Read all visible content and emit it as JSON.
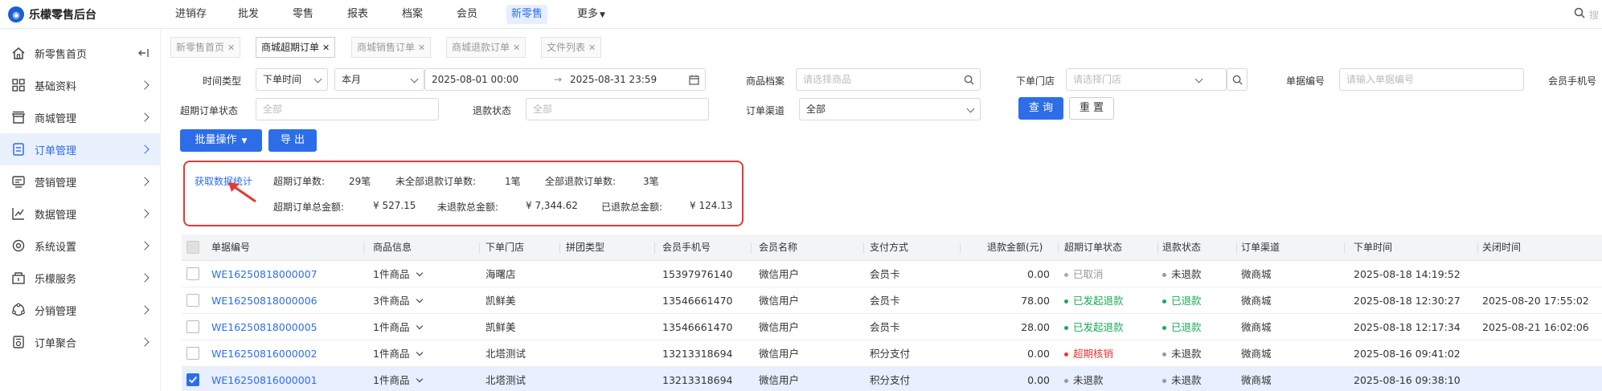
{
  "app": {
    "title": "乐檬零售后台"
  },
  "topnav": {
    "items": [
      {
        "label": "进销存"
      },
      {
        "label": "批发"
      },
      {
        "label": "零售"
      },
      {
        "label": "报表"
      },
      {
        "label": "档案"
      },
      {
        "label": "会员"
      },
      {
        "label": "新零售"
      },
      {
        "label": "更多"
      }
    ],
    "active": "新零售",
    "search_placeholder": "搜"
  },
  "sidebar": {
    "items": [
      {
        "label": "新零售首页",
        "icon": "home-icon"
      },
      {
        "label": "基础资料",
        "icon": "grid-icon"
      },
      {
        "label": "商城管理",
        "icon": "shop-icon"
      },
      {
        "label": "订单管理",
        "icon": "order-icon"
      },
      {
        "label": "营销管理",
        "icon": "marketing-icon"
      },
      {
        "label": "数据管理",
        "icon": "chart-icon"
      },
      {
        "label": "系统设置",
        "icon": "gear-icon"
      },
      {
        "label": "乐檬服务",
        "icon": "service-icon"
      },
      {
        "label": "分销管理",
        "icon": "distribution-icon"
      },
      {
        "label": "订单聚合",
        "icon": "aggregate-icon"
      }
    ],
    "active": "订单管理",
    "collapse_icon": "collapse-icon"
  },
  "tabs": [
    {
      "label": "新零售首页"
    },
    {
      "label": "商城超期订单"
    },
    {
      "label": "商城销售订单"
    },
    {
      "label": "商城退款订单"
    },
    {
      "label": "文件列表"
    }
  ],
  "filters": {
    "time_type_label": "时间类型",
    "time_type_value": "下单时间",
    "period_value": "本月",
    "start_time": "2025-08-01 00:00",
    "end_time": "2025-08-31 23:59",
    "product_label": "商品档案",
    "product_placeholder": "请选择商品",
    "store_label": "下单门店",
    "store_placeholder": "请选择门店",
    "doc_no_label": "单据编号",
    "doc_no_placeholder": "请输入单据编号",
    "member_phone_label": "会员手机号",
    "overdue_status_label": "超期订单状态",
    "overdue_status_value": "全部",
    "refund_status_label": "退款状态",
    "refund_status_value": "全部",
    "channel_label": "订单渠道",
    "channel_value": "全部",
    "query_button": "查 询",
    "reset_button": "重 置"
  },
  "actions": {
    "batch_label": "批量操作",
    "export_label": "导 出"
  },
  "stats": {
    "fetch_link": "获取数据统计",
    "overdue_count_label": "超期订单数:",
    "overdue_count_value": "29笔",
    "partial_refund_label": "未全部退款订单数:",
    "partial_refund_value": "1笔",
    "full_refund_label": "全部退款订单数:",
    "full_refund_value": "3笔",
    "overdue_amount_label": "超期订单总金额:",
    "overdue_amount_value": "¥ 527.15",
    "unrefunded_label": "未退款总金额:",
    "unrefunded_value": "¥ 7,344.62",
    "refunded_label": "已退款总金额:",
    "refunded_value": "¥ 124.13"
  },
  "table": {
    "columns": [
      "单据编号",
      "商品信息",
      "下单门店",
      "拼团类型",
      "会员手机号",
      "会员名称",
      "支付方式",
      "退款金额(元)",
      "超期订单状态",
      "退款状态",
      "订单渠道",
      "下单时间",
      "关闭时间"
    ],
    "rows": [
      {
        "doc_no": "WE16250818000007",
        "goods": "1件商品",
        "store": "海曙店",
        "group": "",
        "phone": "15397976140",
        "member": "微信用户",
        "pay": "会员卡",
        "refund": "0.00",
        "overdue_status": "已取消",
        "overdue_color": "#aaaaaa",
        "refund_status": "未退款",
        "refund_color": "#999999",
        "refund_status_text_color": "#333333",
        "overdue_text_color": "#999999",
        "channel": "微商城",
        "order_time": "2025-08-18 14:19:52",
        "close_time": "",
        "selected": false
      },
      {
        "doc_no": "WE16250818000006",
        "goods": "3件商品",
        "store": "凯鲜美",
        "group": "",
        "phone": "13546661470",
        "member": "微信用户",
        "pay": "会员卡",
        "refund": "78.00",
        "overdue_status": "已发起退款",
        "overdue_color": "#1aaa55",
        "refund_status": "已退款",
        "refund_color": "#1aaa55",
        "refund_status_text_color": "#1aaa55",
        "overdue_text_color": "#1aaa55",
        "channel": "微商城",
        "order_time": "2025-08-18 12:30:27",
        "close_time": "2025-08-20 17:55:02",
        "selected": false
      },
      {
        "doc_no": "WE16250818000005",
        "goods": "1件商品",
        "store": "凯鲜美",
        "group": "",
        "phone": "13546661470",
        "member": "微信用户",
        "pay": "会员卡",
        "refund": "28.00",
        "overdue_status": "已发起退款",
        "overdue_color": "#1aaa55",
        "refund_status": "已退款",
        "refund_color": "#1aaa55",
        "refund_status_text_color": "#1aaa55",
        "overdue_text_color": "#1aaa55",
        "channel": "微商城",
        "order_time": "2025-08-18 12:17:34",
        "close_time": "2025-08-21 16:02:06",
        "selected": false
      },
      {
        "doc_no": "WE16250816000002",
        "goods": "1件商品",
        "store": "北塔测试",
        "group": "",
        "phone": "13213318694",
        "member": "微信用户",
        "pay": "积分支付",
        "refund": "0.00",
        "overdue_status": "超期核销",
        "overdue_color": "#e53935",
        "refund_status": "未退款",
        "refund_color": "#999999",
        "refund_status_text_color": "#333333",
        "overdue_text_color": "#e53935",
        "channel": "微商城",
        "order_time": "2025-08-16 09:41:02",
        "close_time": "",
        "selected": false
      },
      {
        "doc_no": "WE16250816000001",
        "goods": "1件商品",
        "store": "北塔测试",
        "group": "",
        "phone": "13213318694",
        "member": "微信用户",
        "pay": "积分支付",
        "refund": "0.00",
        "overdue_status": "未退款",
        "overdue_color": "#999999",
        "refund_status": "未退款",
        "refund_color": "#999999",
        "refund_status_text_color": "#333333",
        "overdue_text_color": "#333333",
        "channel": "微商城",
        "order_time": "2025-08-16 09:38:10",
        "close_time": "",
        "selected": true
      }
    ]
  },
  "colors": {
    "accent": "#2d6ee8",
    "highlight_border": "#e53935"
  }
}
